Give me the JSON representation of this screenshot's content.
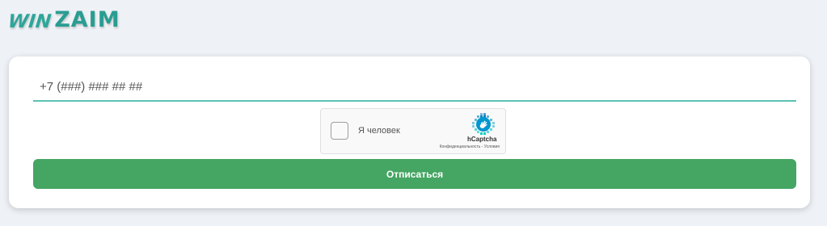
{
  "logo": {
    "part1": "WIN",
    "part2": "ZAIM"
  },
  "form": {
    "phone_placeholder": "+7 (###) ### ## ##",
    "phone_value": ""
  },
  "captcha": {
    "checkbox_label": "Я человек",
    "brand": "hCaptcha",
    "links": "Конфиденциальность - Условия",
    "icon": "hcaptcha-logo-icon"
  },
  "submit": {
    "label": "Отписаться"
  },
  "colors": {
    "background": "#eef2f6",
    "accent_teal": "#2a9d92",
    "input_underline": "#5bc1b3",
    "button_green": "#45a562",
    "button_text": "#ffffff"
  }
}
